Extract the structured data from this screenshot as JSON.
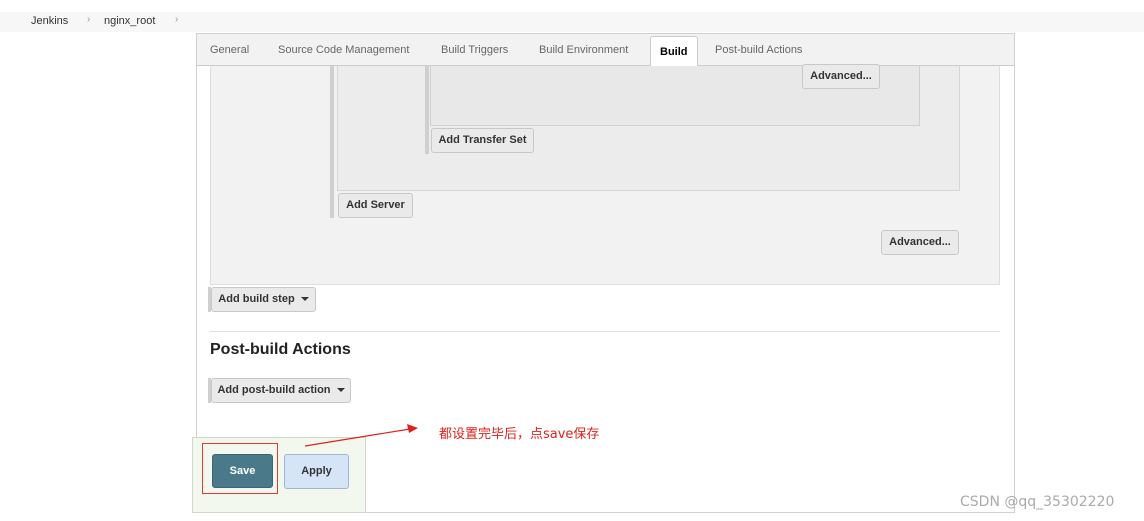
{
  "breadcrumb": {
    "items": [
      "Jenkins",
      "nginx_root"
    ],
    "separator": "›"
  },
  "tabs": [
    {
      "label": "General"
    },
    {
      "label": "Source Code Management"
    },
    {
      "label": "Build Triggers"
    },
    {
      "label": "Build Environment"
    },
    {
      "label": "Build",
      "active": true
    },
    {
      "label": "Post-build Actions"
    }
  ],
  "build": {
    "transfer_advanced_label": "Advanced...",
    "add_transfer_set_label": "Add Transfer Set",
    "add_server_label": "Add Server",
    "advanced_label": "Advanced...",
    "add_build_step_label": "Add build step"
  },
  "post_build": {
    "title": "Post-build Actions",
    "add_action_label": "Add post-build action"
  },
  "actions": {
    "save_label": "Save",
    "apply_label": "Apply"
  },
  "annotation": {
    "text": "都设置完毕后，点save保存",
    "color": "#e0201c"
  },
  "watermark": {
    "text": "CSDN @qq_35302220"
  },
  "colors": {
    "save_bg": "#4a7a8a",
    "apply_bg": "#d5e4f6",
    "highlight": "#e53935"
  }
}
